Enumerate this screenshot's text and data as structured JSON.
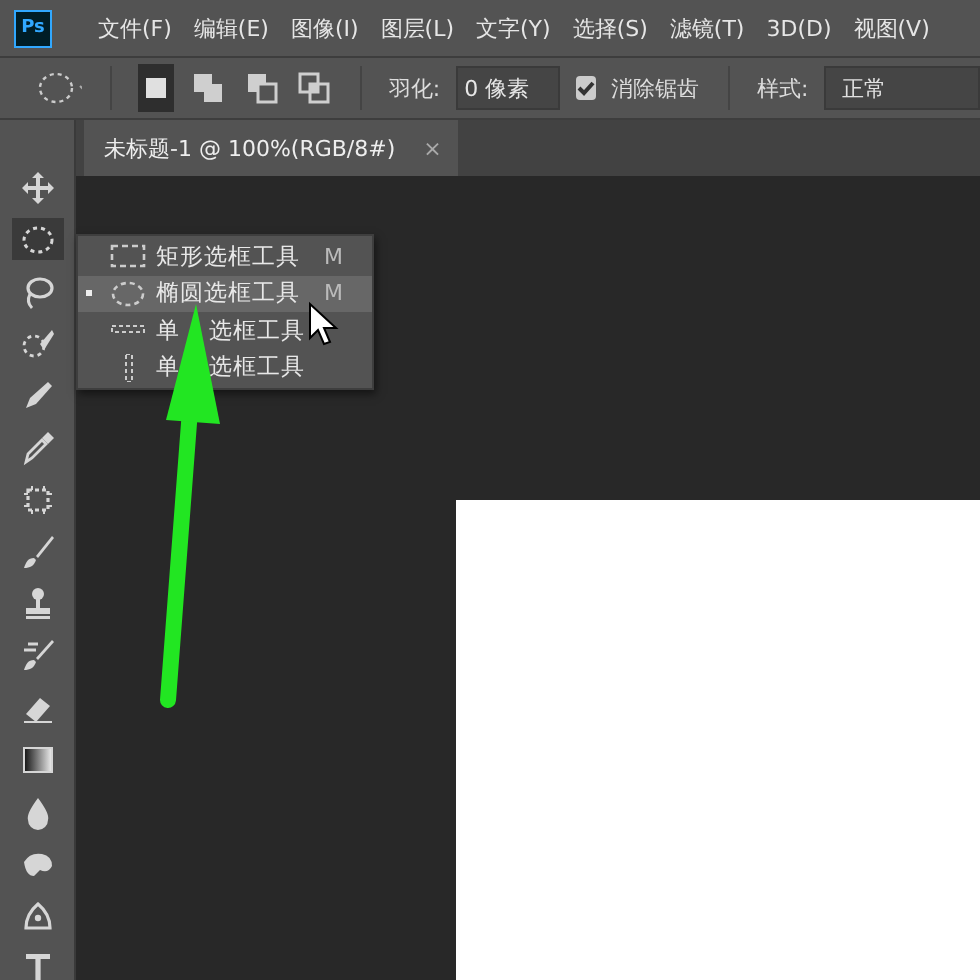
{
  "menu_bar": {
    "logo": "Ps",
    "items": [
      "文件(F)",
      "编辑(E)",
      "图像(I)",
      "图层(L)",
      "文字(Y)",
      "选择(S)",
      "滤镜(T)",
      "3D(D)",
      "视图(V)"
    ]
  },
  "options_bar": {
    "modes": [
      {
        "kind": "new",
        "selected": true
      },
      {
        "kind": "add",
        "selected": false
      },
      {
        "kind": "subtract",
        "selected": false
      },
      {
        "kind": "intersect",
        "selected": false
      }
    ],
    "feather_label": "羽化:",
    "feather_value": "0 像素",
    "antialias": {
      "label": "消除锯齿",
      "checked": true
    },
    "style_label": "样式:",
    "style_value": "正常"
  },
  "document_tab": {
    "title": "未标题-1 @ 100%(RGB/8#)",
    "close": "×"
  },
  "tools": [
    {
      "kind": "move",
      "selected": false
    },
    {
      "kind": "ellipse",
      "selected": true
    },
    {
      "kind": "lasso",
      "selected": false
    },
    {
      "kind": "quick",
      "selected": false
    },
    {
      "kind": "pencil",
      "selected": false
    },
    {
      "kind": "eyedropper",
      "selected": false
    },
    {
      "kind": "frame",
      "selected": false
    },
    {
      "kind": "brush",
      "selected": false
    },
    {
      "kind": "stamp",
      "selected": false
    },
    {
      "kind": "history",
      "selected": false
    },
    {
      "kind": "eraser",
      "selected": false
    },
    {
      "kind": "gradient",
      "selected": false
    },
    {
      "kind": "drop",
      "selected": false
    },
    {
      "kind": "smudge",
      "selected": false
    },
    {
      "kind": "pen",
      "selected": false
    },
    {
      "kind": "type",
      "selected": false
    }
  ],
  "flyout": [
    {
      "kind": "rect",
      "label": "矩形选框工具",
      "shortcut": "M",
      "selected": false
    },
    {
      "kind": "ellipse",
      "label": "椭圆选框工具",
      "shortcut": "M",
      "selected": true
    },
    {
      "kind": "row",
      "label_parts": [
        "单",
        "选框工具"
      ],
      "selected": false
    },
    {
      "kind": "column",
      "label_parts": [
        "单",
        "选框工具"
      ],
      "selected": false
    }
  ]
}
